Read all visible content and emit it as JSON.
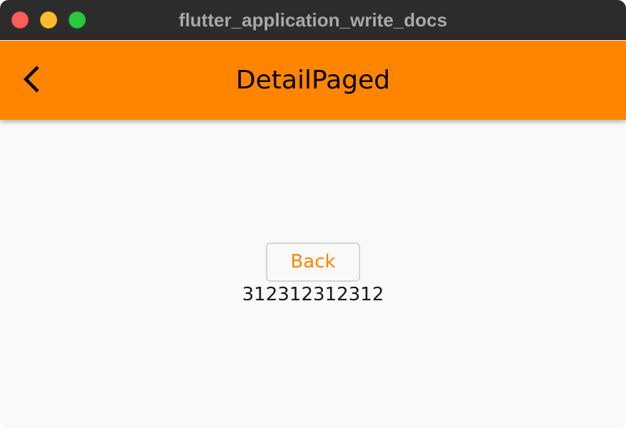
{
  "window": {
    "title": "flutter_application_write_docs"
  },
  "appbar": {
    "title": "DetailPaged",
    "back_icon": "chevron-left-icon",
    "background_color": "#ff8500"
  },
  "main": {
    "back_button_label": "Back",
    "value_text": "312312312312",
    "accent_color": "#ff8500"
  }
}
